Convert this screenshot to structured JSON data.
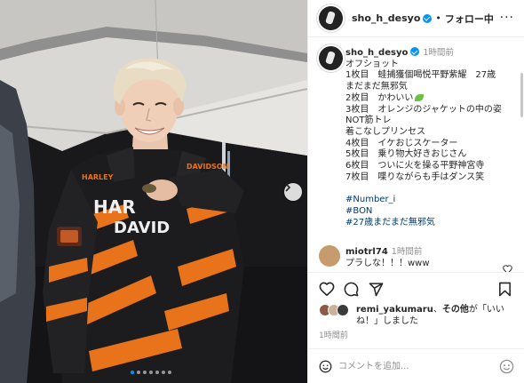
{
  "header": {
    "username": "sho_h_desyo",
    "separator": "•",
    "follow_label": "フォロー中",
    "more_label": "···"
  },
  "caption": {
    "username": "sho_h_desyo",
    "time": "1時間前",
    "lines": [
      "オフショット",
      "1枚目　蛙捕獲個喝悦平野紫耀　27歳",
      "まだまだ無邪気",
      "2枚目　かわいい",
      "3枚目　オレンジのジャケットの中の姿",
      "NOT筋トレ",
      "着こなしプリンセス",
      "4枚目　イケおじスケーター",
      "5枚目　乗り物大好きおじさん",
      "6枚目　ついに火を操る平野神宮寺",
      "7枚目　喋りながらも手はダンス笑"
    ],
    "hashtags": [
      "#Number_i",
      "#BON",
      "#27歳まだまだ無邪気"
    ]
  },
  "reply": {
    "username": "miotrl74",
    "time": "1時間前",
    "text": "プラしな！！！www"
  },
  "likes": {
    "username": "remi_yakumaru",
    "connector": "、",
    "others": "その他",
    "suffix": "が「いいね！」しました",
    "face_colors": [
      "#8a5a44",
      "#c9b29b",
      "#3a3a3a"
    ]
  },
  "post_time": "1時間前",
  "comment_input": {
    "placeholder": "コメントを追加..."
  },
  "carousel": {
    "total": 7,
    "active_index": 0
  },
  "colors": {
    "accent": "#0095f6",
    "hashtag": "#00376b",
    "jacket_orange": "#e8731a"
  }
}
